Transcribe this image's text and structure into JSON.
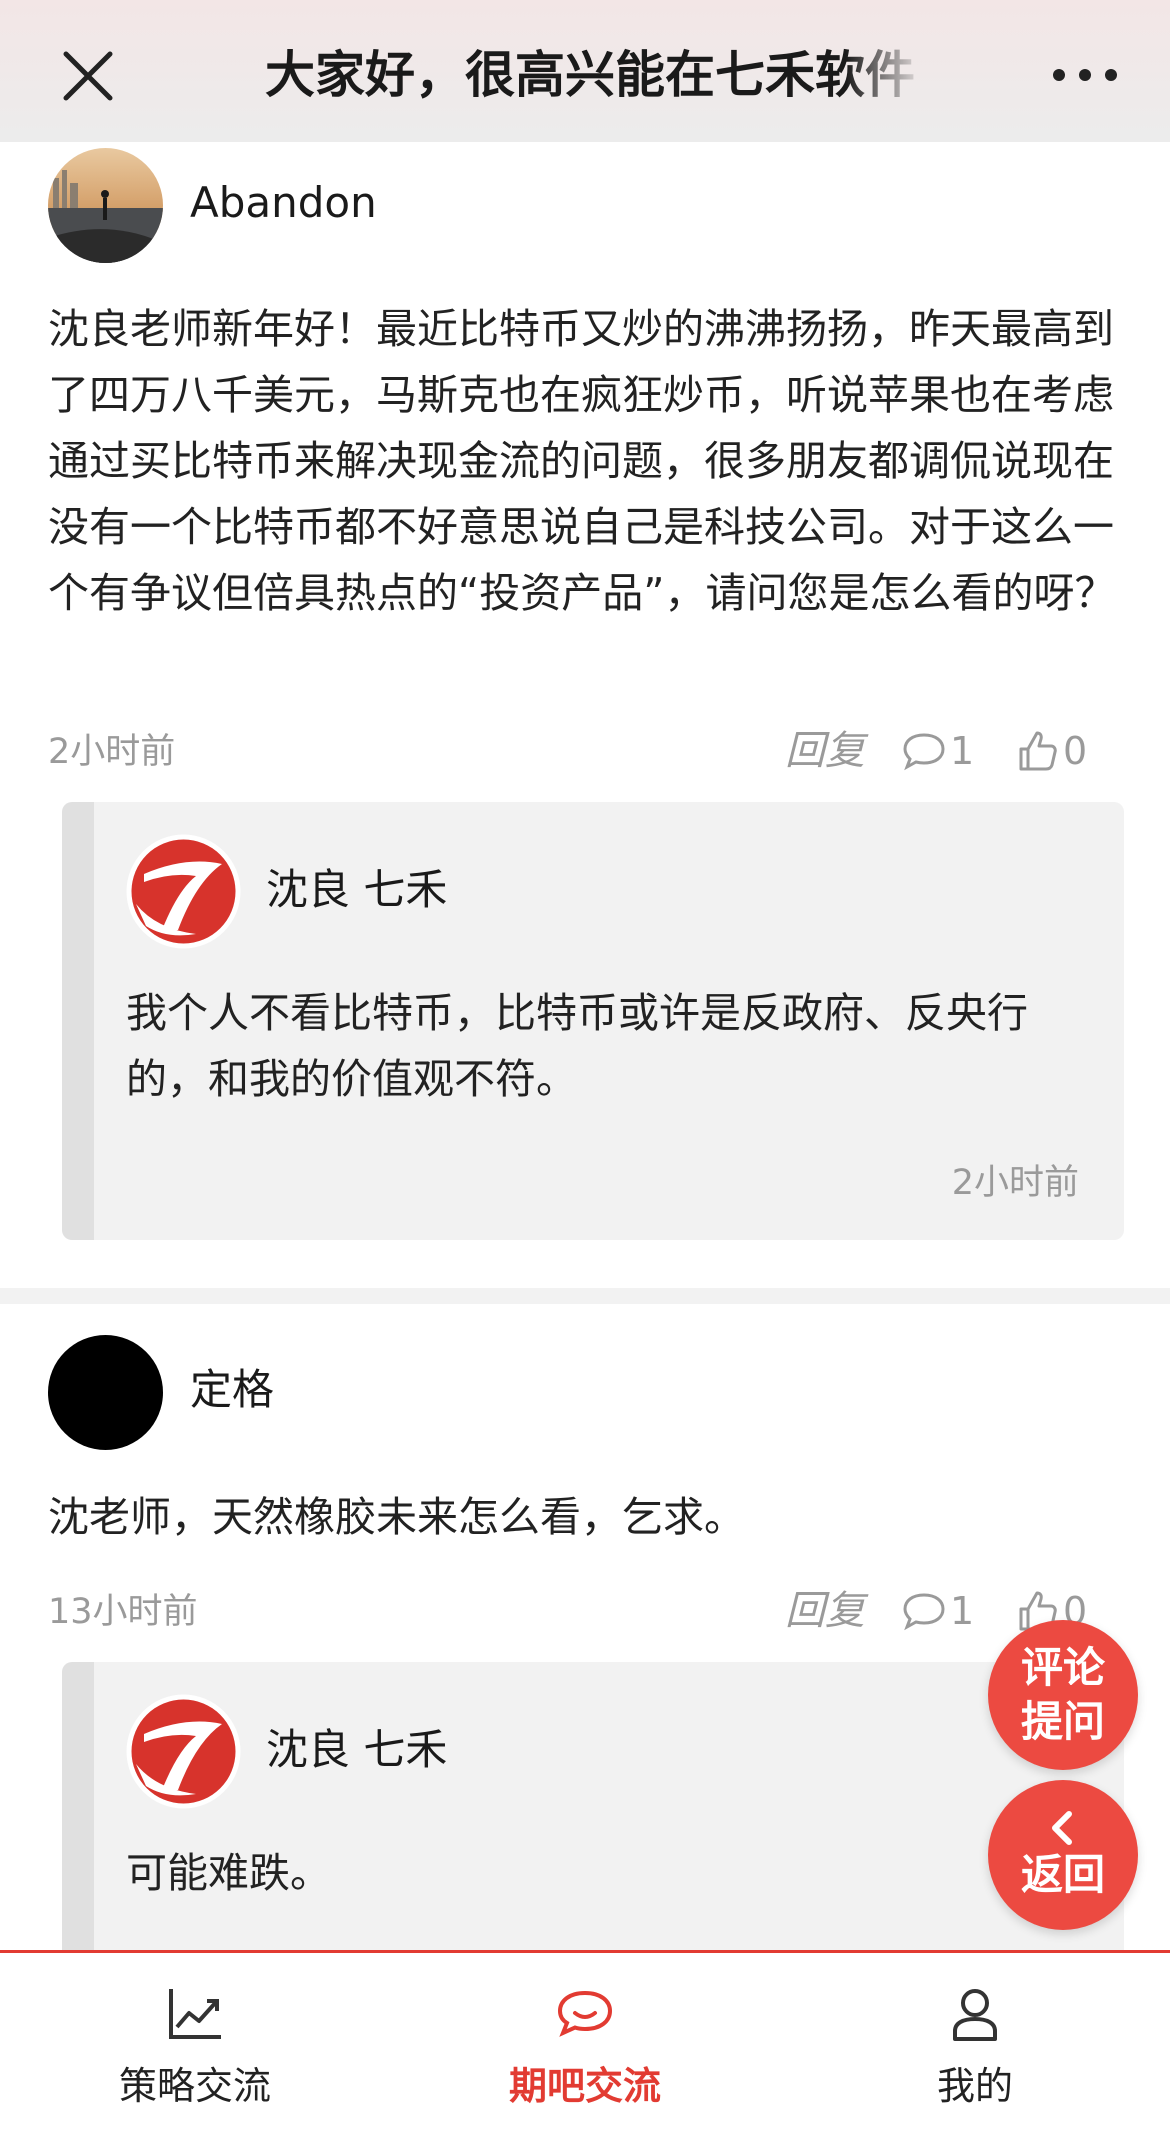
{
  "header": {
    "title": "大家好，很高兴能在七禾软件"
  },
  "comments": [
    {
      "username": "Abandon",
      "text": "沈良老师新年好！最近比特币又炒的沸沸扬扬，昨天最高到了四万八千美元，马斯克也在疯狂炒币，听说苹果也在考虑通过买比特币来解决现金流的问题，很多朋友都调侃说现在没有一个比特币都不好意思说自己是科技公司。对于这么一个有争议但倍具热点的“投资产品”，请问您是怎么看的呀？",
      "time": "2小时前",
      "reply_label": "回复",
      "comment_count": "1",
      "like_count": "0",
      "reply": {
        "name": "沈良 七禾",
        "text": "我个人不看比特币，比特币或许是反政府、反央行的，和我的价值观不符。",
        "time": "2小时前"
      }
    },
    {
      "username": "定格",
      "text": "沈老师，天然橡胶未来怎么看，乞求。",
      "time": "13小时前",
      "reply_label": "回复",
      "comment_count": "1",
      "like_count": "0",
      "reply": {
        "name": "沈良 七禾",
        "text": "可能难跌。"
      }
    }
  ],
  "fab": {
    "ask_line1": "评论",
    "ask_line2": "提问",
    "back_label": "返回"
  },
  "tabs": [
    {
      "label": "策略交流",
      "icon": "chart-line-icon"
    },
    {
      "label": "期吧交流",
      "icon": "chat-bubble-icon"
    },
    {
      "label": "我的",
      "icon": "user-icon"
    }
  ],
  "colors": {
    "accent": "#e23b32",
    "fab": "#ec4a41",
    "muted": "#9a9a9a"
  }
}
